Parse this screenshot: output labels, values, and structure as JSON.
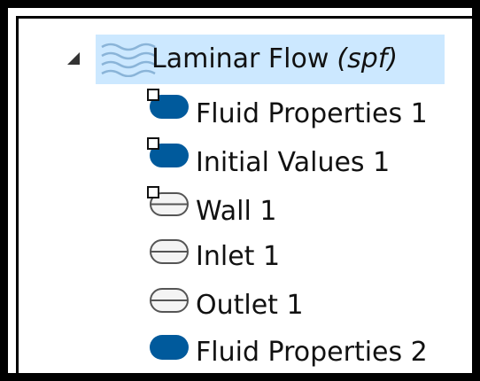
{
  "tree": {
    "parent": {
      "label": "Laminar Flow",
      "tag": "(spf)",
      "icon": "laminar-flow-waves-icon",
      "expanded": true,
      "selected": true
    },
    "children": [
      {
        "label": "Fluid Properties 1",
        "icon": "filled-node-with-default-marker-icon"
      },
      {
        "label": "Initial Values 1",
        "icon": "filled-node-with-default-marker-icon"
      },
      {
        "label": "Wall 1",
        "icon": "outlined-node-with-default-marker-icon"
      },
      {
        "label": "Inlet 1",
        "icon": "outlined-node-icon"
      },
      {
        "label": "Outlet 1",
        "icon": "outlined-node-icon"
      },
      {
        "label": "Fluid Properties 2",
        "icon": "filled-node-icon"
      }
    ]
  },
  "colors": {
    "selection": "#cce8ff",
    "node_fill": "#005a9c",
    "node_outline": "#555555",
    "waves": "#8ab4d8"
  }
}
